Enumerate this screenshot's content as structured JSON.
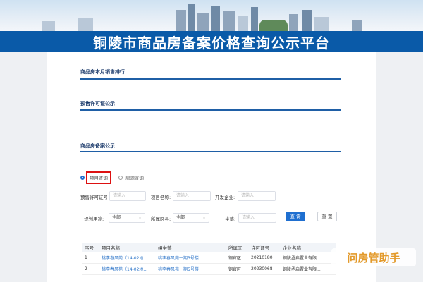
{
  "header": {
    "title": "铜陵市商品房备案价格查询公示平台"
  },
  "sections": {
    "monthly_sales": "商品房本月销售排行",
    "presale_permit": "预售许可证公示",
    "filing": "商品房备案公示"
  },
  "query_mode": {
    "project": "项目查询",
    "house": "房源查询",
    "selected": "project"
  },
  "filters": {
    "permit_label": "预售许可证号：",
    "permit_placeholder": "请输入",
    "project_label": "项目名称:",
    "project_placeholder": "请输入",
    "developer_label": "开发企业:",
    "developer_placeholder": "请输入",
    "usage_label": "规划用途:",
    "usage_value": "全部",
    "district_label": "所属区县:",
    "district_value": "全部",
    "location_label": "坐落:",
    "location_placeholder": "请输入",
    "query_button": "查 询",
    "reset_button": "重 置"
  },
  "table": {
    "headers": [
      "序号",
      "项目名称",
      "幢坐落",
      "所属区",
      "许可证号",
      "企业名称"
    ],
    "rows": [
      [
        "1",
        "桃李春风苑（14-02地...",
        "桃李春风苑一期3号楼",
        "铜官区",
        "20210180",
        "铜陵丞启置业有限..."
      ],
      [
        "2",
        "桃李春风苑（14-02地...",
        "桃李春风苑一期5号楼",
        "铜官区",
        "20230068",
        "铜陵丞启置业有限..."
      ]
    ]
  },
  "watermark": "问房管助手",
  "colors": {
    "brand_blue": "#0a5aa8",
    "accent_blue": "#1f6fd0",
    "highlight_red": "#dd1111",
    "watermark_orange": "#e39a2b"
  }
}
